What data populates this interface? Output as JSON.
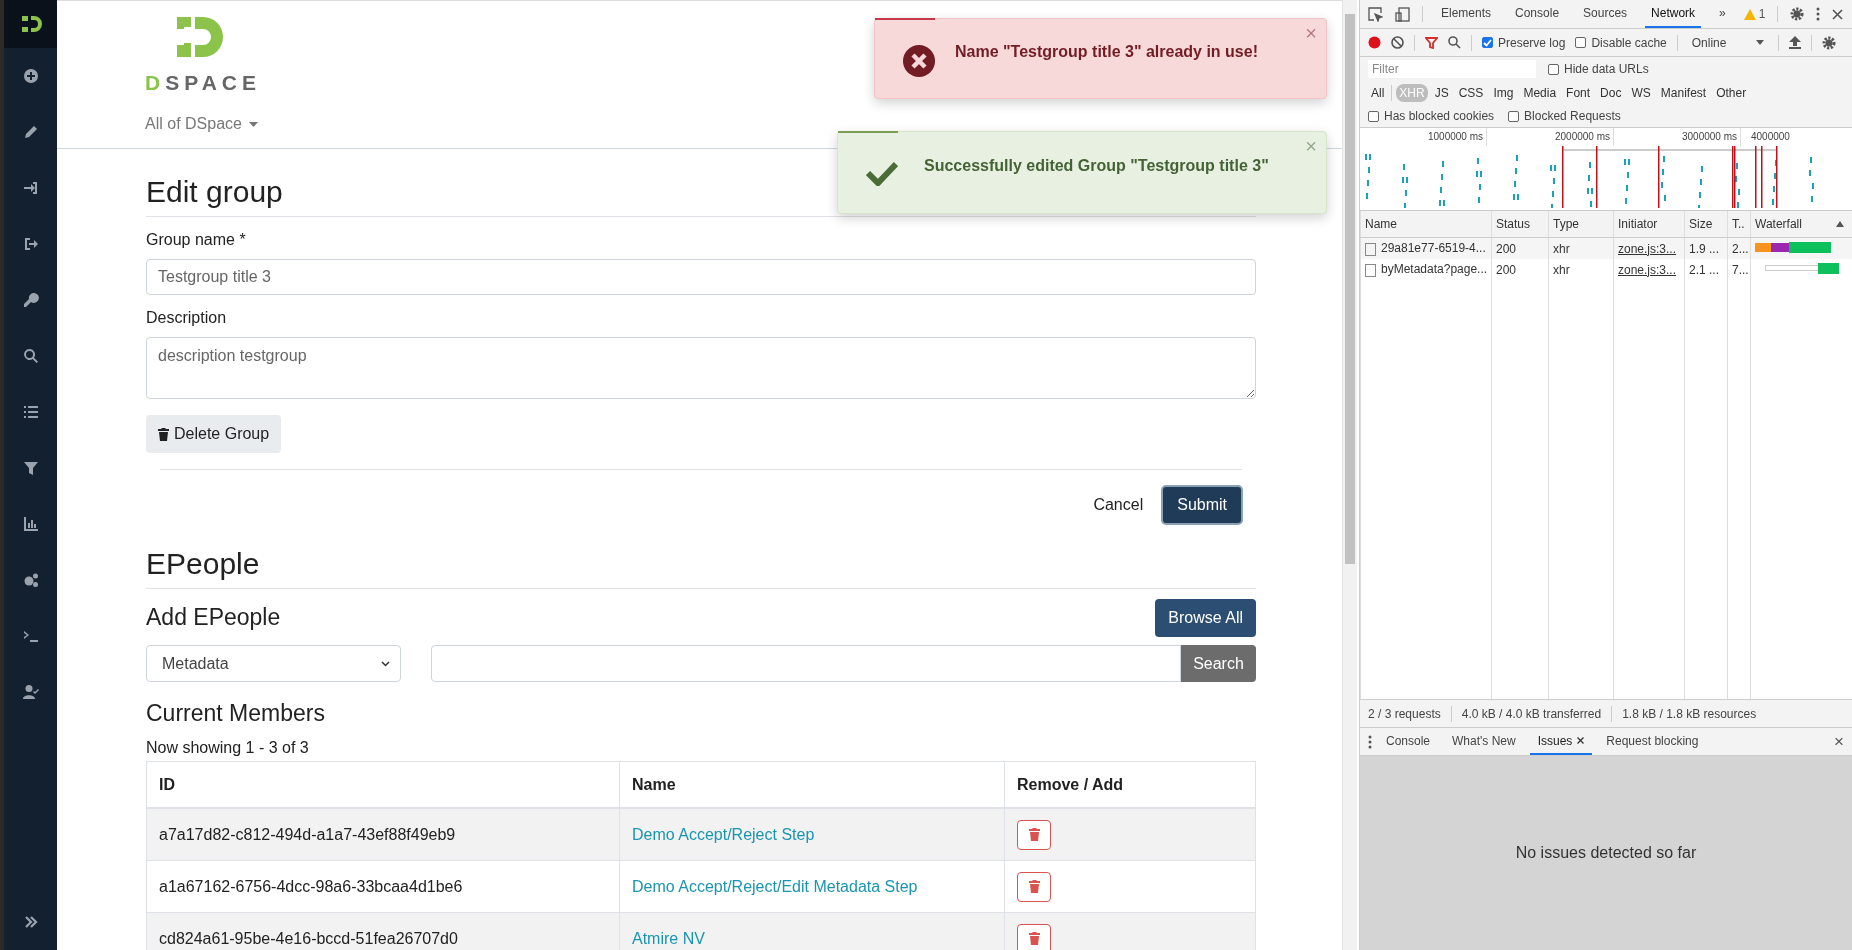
{
  "header": {
    "logo": "DSPACE",
    "scope_selector": "All of DSpace"
  },
  "toasts": [
    {
      "kind": "error",
      "message": "Name \"Testgroup title 3\" already in use!",
      "close": "×"
    },
    {
      "kind": "success",
      "message": "Successfully edited Group \"Testgroup title 3\"",
      "close": "×"
    }
  ],
  "form": {
    "title": "Edit group",
    "name_label": "Group name *",
    "name_value": "Testgroup title 3",
    "description_label": "Description",
    "description_value": "description testgroup",
    "delete_button": "Delete Group",
    "cancel_button": "Cancel",
    "submit_button": "Submit"
  },
  "epeople": {
    "title": "EPeople",
    "add_title": "Add EPeople",
    "browse_all": "Browse All",
    "scope_select": "Metadata",
    "search_button": "Search",
    "members_title": "Current Members",
    "showing": "Now showing 1 - 3 of 3",
    "columns": [
      "ID",
      "Name",
      "Remove / Add"
    ],
    "rows": [
      {
        "id": "a7a17d82-c812-494d-a1a7-43ef88f49eb9",
        "name": "Demo Accept/Reject Step"
      },
      {
        "id": "a1a67162-6756-4dcc-98a6-33bcaa4d1be6",
        "name": "Demo Accept/Reject/Edit Metadata Step"
      },
      {
        "id": "cd824a61-95be-4e16-bccd-51fea26707d0",
        "name": "Atmire NV"
      }
    ]
  },
  "devtools": {
    "tabs": [
      {
        "label": "Elements",
        "selected": false
      },
      {
        "label": "Console",
        "selected": false
      },
      {
        "label": "Sources",
        "selected": false
      },
      {
        "label": "Network",
        "selected": true
      }
    ],
    "more": "»",
    "warnings": "1",
    "preserve_log": {
      "label": "Preserve log",
      "checked": true
    },
    "disable_cache": {
      "label": "Disable cache",
      "checked": false
    },
    "throttling": "Online",
    "filter_placeholder": "Filter",
    "hide_data_urls": {
      "label": "Hide data URLs",
      "checked": false
    },
    "types": [
      {
        "label": "All",
        "selected": false
      },
      {
        "label": "XHR",
        "selected": true
      },
      {
        "label": "JS",
        "selected": false
      },
      {
        "label": "CSS",
        "selected": false
      },
      {
        "label": "Img",
        "selected": false
      },
      {
        "label": "Media",
        "selected": false
      },
      {
        "label": "Font",
        "selected": false
      },
      {
        "label": "Doc",
        "selected": false
      },
      {
        "label": "WS",
        "selected": false
      },
      {
        "label": "Manifest",
        "selected": false
      },
      {
        "label": "Other",
        "selected": false
      }
    ],
    "has_blocked_cookies": {
      "label": "Has blocked cookies",
      "checked": false
    },
    "blocked_requests": {
      "label": "Blocked Requests",
      "checked": false
    },
    "overview_ticks": [
      "1000000 ms",
      "2000000 ms",
      "3000000 ms",
      "4000000"
    ],
    "columns": [
      "Name",
      "Status",
      "Type",
      "Initiator",
      "Size",
      "T..",
      "Waterfall"
    ],
    "requests": [
      {
        "name": "29a81e77-6519-4...",
        "status": "200",
        "type": "xhr",
        "initiator": "zone.js:3...",
        "size": "1.9 ...",
        "time": "2..."
      },
      {
        "name": "byMetadata?page...",
        "status": "200",
        "type": "xhr",
        "initiator": "zone.js:3...",
        "size": "2.1 ...",
        "time": "7..."
      }
    ],
    "summary": [
      "2 / 3 requests",
      "4.0 kB / 4.0 kB transferred",
      "1.8 kB / 1.8 kB resources"
    ],
    "drawer_tabs": [
      {
        "label": "Console",
        "selected": false,
        "closable": false
      },
      {
        "label": "What's New",
        "selected": false,
        "closable": false
      },
      {
        "label": "Issues",
        "selected": true,
        "closable": true
      },
      {
        "label": "Request blocking",
        "selected": false,
        "closable": false
      }
    ],
    "drawer_close": "×",
    "issues_message": "No issues detected so far"
  }
}
